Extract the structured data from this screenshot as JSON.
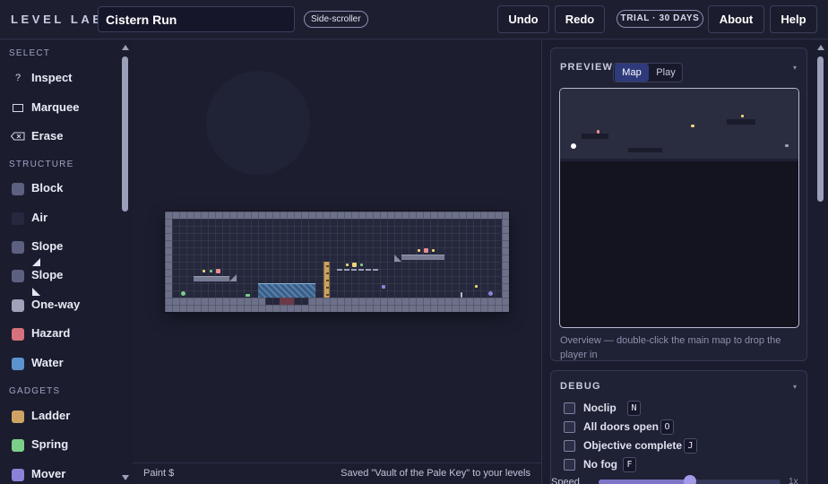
{
  "app": {
    "brand": "LEVEL LAB",
    "level_title": "Cistern Run",
    "genre": "Side-scroller",
    "undo": "Undo",
    "redo": "Redo",
    "trial": "TRIAL · 30 DAYS",
    "about": "About",
    "help": "Help"
  },
  "sidebar": {
    "select_heading": "SELECT",
    "structure_heading": "STRUCTURE",
    "gadgets_heading": "GADGETS",
    "select_tools": [
      {
        "label": "Inspect",
        "icon": "question-mark-icon"
      },
      {
        "label": "Marquee",
        "icon": "rectangle-icon"
      },
      {
        "label": "Erase",
        "icon": "eraser-icon"
      }
    ],
    "structure_tools": [
      {
        "label": "Block",
        "color": "#5d6080"
      },
      {
        "label": "Air",
        "color": "#262840"
      },
      {
        "label": "Slope",
        "color": "#5d6080",
        "icon": "slope-up-icon"
      },
      {
        "label": "Slope",
        "color": "#5d6080",
        "icon": "slope-down-icon"
      },
      {
        "label": "One-way",
        "color": "#9fa2b8"
      },
      {
        "label": "Hazard",
        "color": "#d6727c"
      },
      {
        "label": "Water",
        "color": "#5c93cf"
      }
    ],
    "gadget_tools": [
      {
        "label": "Ladder",
        "color": "#cfa363"
      },
      {
        "label": "Spring",
        "color": "#7ccf88"
      },
      {
        "label": "Mover",
        "color": "#8c82d8"
      }
    ]
  },
  "status": {
    "left": "Paint $",
    "right": "Saved \"Vault of the Pale Key\" to your levels"
  },
  "preview": {
    "title": "PREVIEW",
    "tab_map": "Map",
    "tab_play": "Play",
    "active_tab": "Map",
    "hint": "Overview — double-click the main map to drop the player in"
  },
  "debug": {
    "title": "DEBUG",
    "options": [
      {
        "label": "Noclip",
        "key": "N",
        "checked": false
      },
      {
        "label": "All doors open",
        "key": "O",
        "checked": false
      },
      {
        "label": "Objective complete",
        "key": "J",
        "checked": false
      },
      {
        "label": "No fog",
        "key": "F",
        "checked": false
      }
    ],
    "speed_label": "Speed",
    "speed_value": "1x",
    "speed_fraction": 0.5
  },
  "colors": {
    "accent": "#8076c8",
    "hazard": "#d6727c",
    "water": "#5c93cf",
    "ladder": "#cfa363",
    "spring": "#7ccf88",
    "mover": "#8c82d8"
  }
}
